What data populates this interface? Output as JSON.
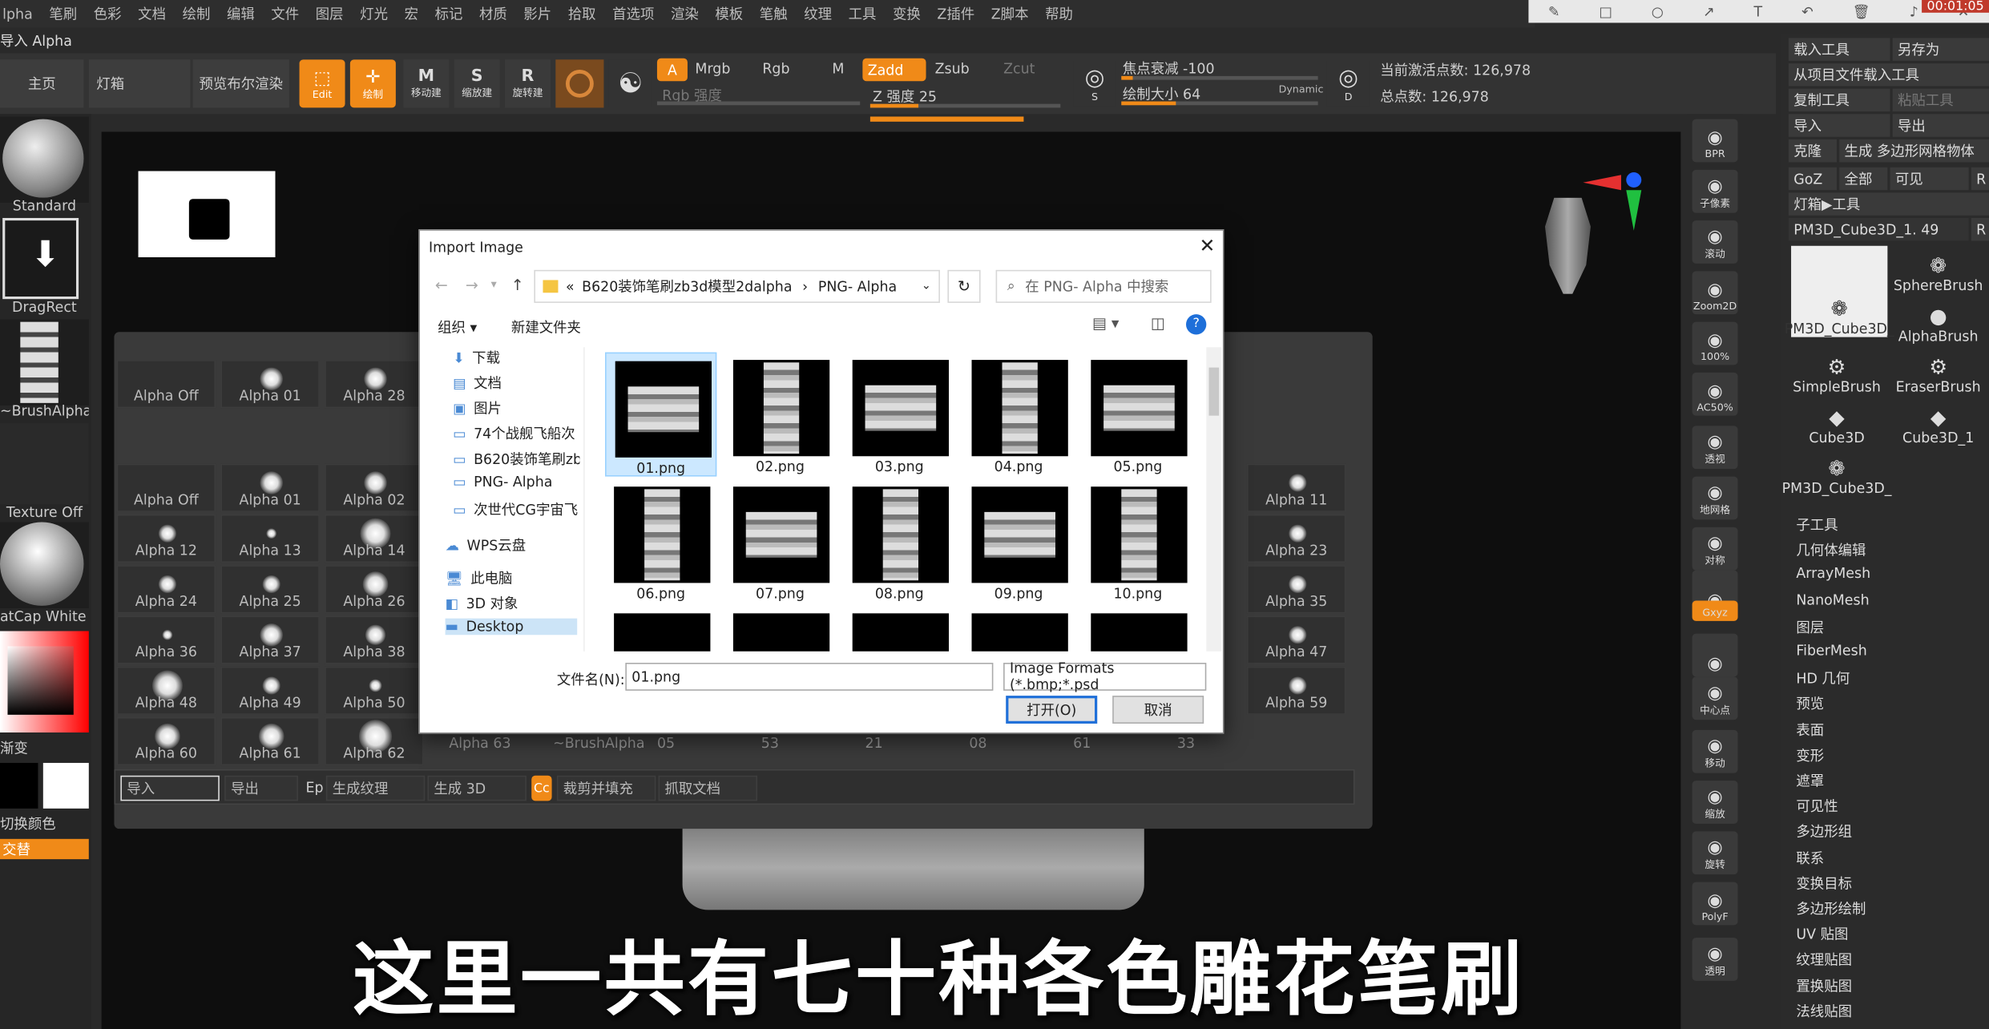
{
  "menu": [
    "lpha",
    "笔刷",
    "色彩",
    "文档",
    "绘制",
    "编辑",
    "文件",
    "图层",
    "灯光",
    "宏",
    "标记",
    "材质",
    "影片",
    "拾取",
    "首选项",
    "渲染",
    "模板",
    "笔触",
    "纹理",
    "工具",
    "变换",
    "Z插件",
    "Z脚本",
    "帮助"
  ],
  "top_left_label": "导入 Alpha",
  "time_badge": "00:01:05",
  "toolbar": {
    "home": "主页",
    "lightbox": "灯箱",
    "preview": "预览布尔渲染",
    "edit": "Edit",
    "draw": "绘制",
    "move": "移动建",
    "scale": "缩放建",
    "rotate": "旋转建",
    "a": "A",
    "mrgb": "Mrgb",
    "rgb": "Rgb",
    "m": "M",
    "zadd": "Zadd",
    "zsub": "Zsub",
    "zcut": "Zcut",
    "rgb_intensity": "Rgb 强度",
    "z_intensity": "Z 强度 25",
    "focal": "焦点衰减 -100",
    "draw_size": "绘制大小 64",
    "dynamic": "Dynamic",
    "active_points": "当前激活点数: 126,978",
    "total_points": "总点数: 126,978",
    "s_label": "S",
    "d_label": "D"
  },
  "left": {
    "standard": "Standard",
    "dragrect": "DragRect",
    "brushalpha": "~BrushAlpha",
    "texture_off": "Texture Off",
    "matcap": "atCap White C",
    "gradient": "渐变",
    "switch": "切换颜色",
    "alternate": "交替"
  },
  "alpha_row1": [
    "Alpha Off",
    "Alpha 01",
    "Alpha 28"
  ],
  "alpha_grid": [
    [
      "Alpha Off",
      "Alpha 01",
      "Alpha 02"
    ],
    [
      "Alpha 12",
      "Alpha 13",
      "Alpha 14"
    ],
    [
      "Alpha 24",
      "Alpha 25",
      "Alpha 26"
    ],
    [
      "Alpha 36",
      "Alpha 37",
      "Alpha 38"
    ],
    [
      "Alpha 48",
      "Alpha 49",
      "Alpha 50"
    ],
    [
      "Alpha 60",
      "Alpha 61",
      "Alpha 62"
    ]
  ],
  "alpha_right": [
    "Alpha 11",
    "Alpha 23",
    "Alpha 35",
    "Alpha 47",
    "Alpha 59"
  ],
  "alpha_extra_row": [
    "Alpha 63",
    "~BrushAlpha",
    "05",
    "53",
    "21",
    "08",
    "61",
    "33"
  ],
  "alpha_bottom": {
    "import": "导入",
    "export": "导出",
    "ep": "Ep",
    "make_texture": "生成纹理",
    "make_3d": "生成 3D",
    "cc": "Cc",
    "crop_fill": "裁剪并填充",
    "grab_doc": "抓取文档"
  },
  "dialog": {
    "title": "Import Image",
    "path_prefix": "«",
    "path_folder": "B620装饰笔刷zb3d模型2dalpha",
    "path_sub": "PNG- Alpha",
    "search_placeholder": "在 PNG- Alpha 中搜索",
    "organize": "组织 ▾",
    "new_folder": "新建文件夹",
    "help": "?",
    "nav": [
      "下载",
      "文档",
      "图片",
      "74个战舰飞船次",
      "B620装饰笔刷zb",
      "PNG- Alpha",
      "次世代CG宇宙飞",
      "WPS云盘",
      "此电脑",
      "3D 对象",
      "Desktop"
    ],
    "files": [
      "01.png",
      "02.png",
      "03.png",
      "04.png",
      "05.png",
      "06.png",
      "07.png",
      "08.png",
      "09.png",
      "10.png"
    ],
    "filename_label": "文件名(N):",
    "filename_value": "01.png",
    "filter": "Image Formats (*.bmp;*.psd",
    "open": "打开(O)",
    "cancel": "取消"
  },
  "right_nav": [
    "BPR",
    "子像素",
    "滚动",
    "Zoom2D",
    "100%",
    "AC50%",
    "透视",
    "地网格",
    "对称",
    "",
    "Gxyz",
    "",
    "中心点",
    "移动",
    "缩放",
    "旋转",
    "PolyF",
    "透明"
  ],
  "right_panel": {
    "load_tool": "载入工具",
    "save_as": "另存为",
    "load_from_project": "从项目文件载入工具",
    "copy_tool": "复制工具",
    "paste_tool": "粘贴工具",
    "import": "导入",
    "export": "导出",
    "clone": "克隆",
    "make_polymesh": "生成 多边形网格物体",
    "goz": "GoZ",
    "all": "全部",
    "visible": "可见",
    "r": "R",
    "lightbox_tool": "灯箱▶工具",
    "current_tool": "PM3D_Cube3D_1. 49",
    "tools": [
      "PM3D_Cube3D_",
      "SphereBrush",
      "AlphaBrush",
      "SimpleBrush",
      "EraserBrush",
      "Cube3D",
      "Cube3D_1",
      "PM3D_Cube3D_"
    ],
    "items": [
      "子工具",
      "几何体编辑",
      "ArrayMesh",
      "NanoMesh",
      "图层",
      "FiberMesh",
      "HD 几何",
      "预览",
      "表面",
      "变形",
      "遮罩",
      "可见性",
      "多边形组",
      "联系",
      "变换目标",
      "多边形绘制",
      "UV 贴图",
      "纹理贴图",
      "置换贴图",
      "法线贴图"
    ]
  },
  "subtitle": "这里一共有七十种各色雕花笔刷",
  "colors": {
    "accent": "#f08a18",
    "bg": "#2a2a2a"
  }
}
